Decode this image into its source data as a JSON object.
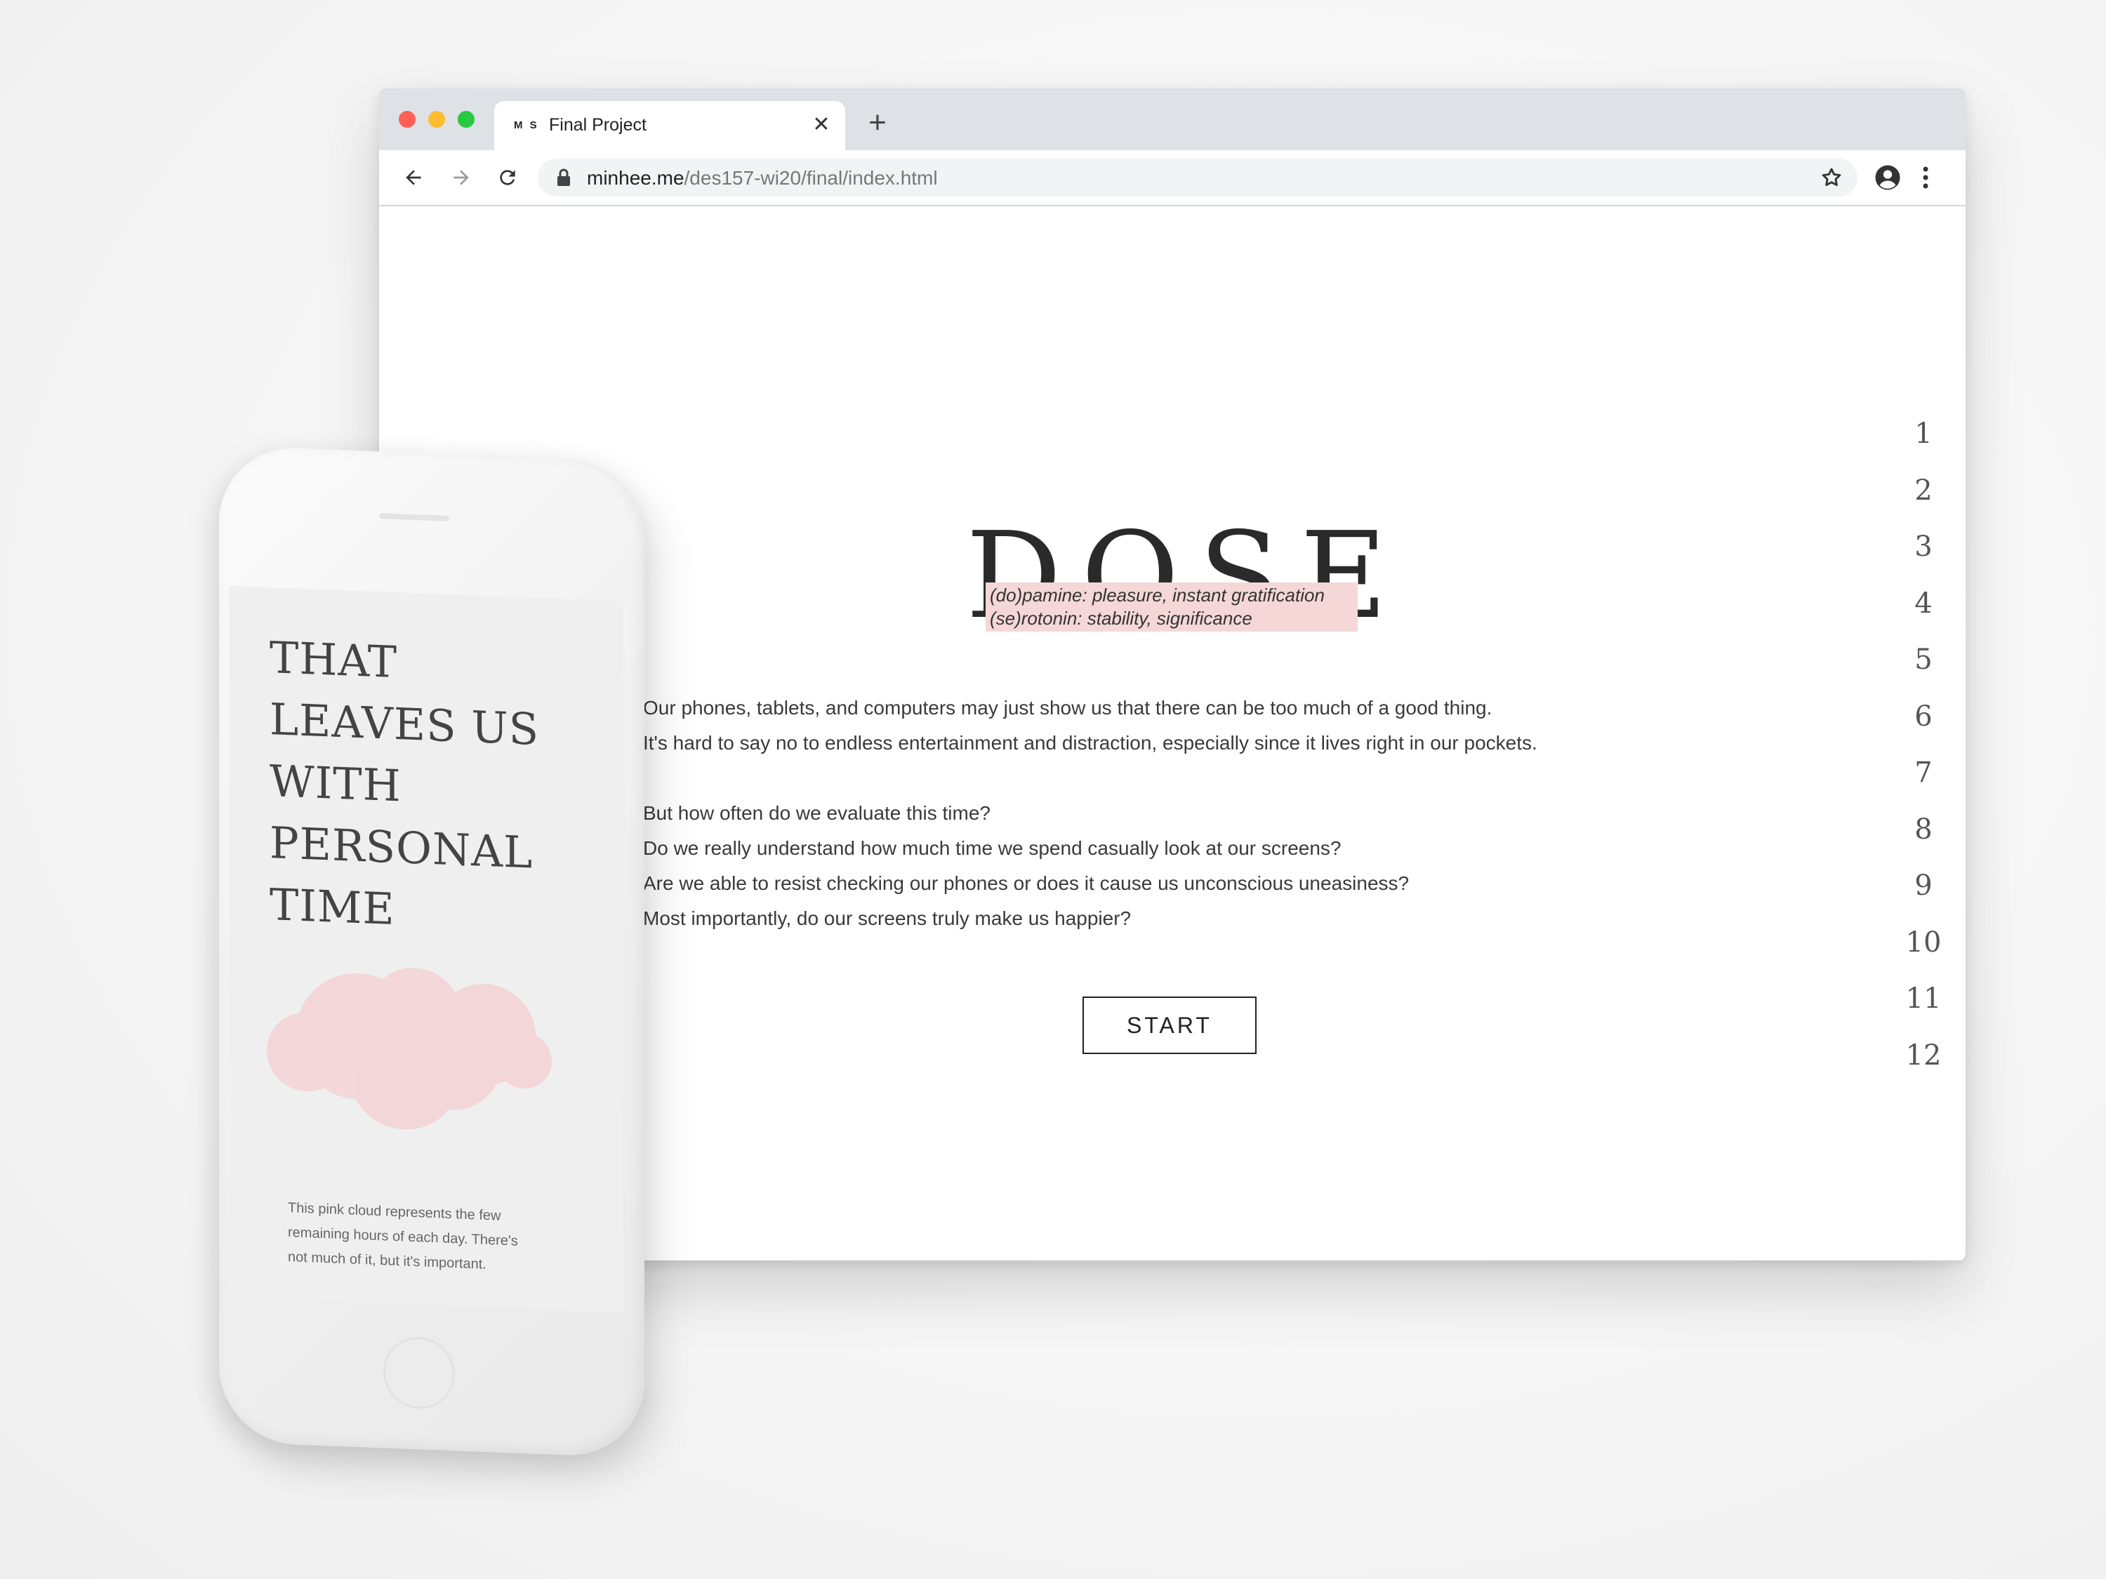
{
  "browser": {
    "tab": {
      "favicon_text": "M S",
      "title": "Final Project",
      "close_symbol": "✕"
    },
    "new_tab_symbol": "+",
    "url_host": "minhee.me",
    "url_path": "/des157-wi20/final/index.html",
    "icons": {
      "back": "arrow-left-icon",
      "forward": "arrow-right-icon",
      "reload": "reload-icon",
      "lock": "lock-icon",
      "star": "star-icon",
      "account": "account-circle-icon",
      "menu": "kebab-menu-icon"
    }
  },
  "page": {
    "logo": "DOSE",
    "definitions": [
      "(do)pamine: pleasure, instant gratification",
      "(se)rotonin: stability, significance"
    ],
    "intro_lines_1": [
      "Our phones, tablets, and computers may just show us that there can be too much of a good thing.",
      "It's hard to say no to endless entertainment and distraction, especially since it lives right in our pockets."
    ],
    "intro_lines_2": [
      "But how often do we evaluate this time?",
      "Do we really understand how much time we spend casually look at our screens?",
      "Are we able to resist checking our phones or does it cause us unconscious uneasiness?",
      "Most importantly, do our screens truly make us happier?"
    ],
    "start_label": "START",
    "page_numbers": [
      "1",
      "2",
      "3",
      "4",
      "5",
      "6",
      "7",
      "8",
      "9",
      "10",
      "11",
      "12"
    ],
    "highlight_color": "#f5d7d8"
  },
  "phone": {
    "heading_lines": [
      "THAT",
      "LEAVES US",
      "WITH",
      "PERSONAL",
      "TIME"
    ],
    "caption": "This pink cloud represents the few remaining hours of each day. There's not much of it, but it's important.",
    "cloud_color": "#f4d4d6"
  }
}
